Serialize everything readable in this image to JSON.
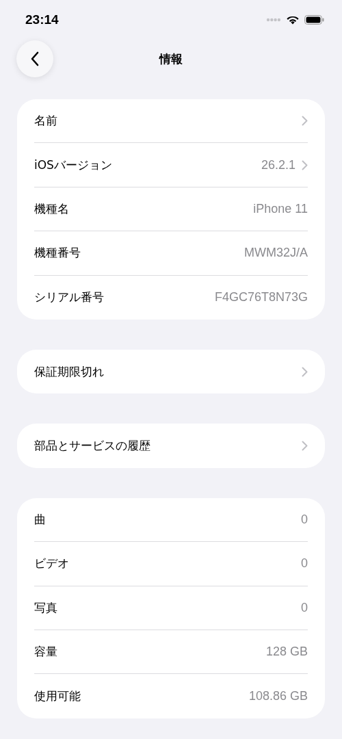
{
  "status_bar": {
    "time": "23:14"
  },
  "nav": {
    "title": "情報"
  },
  "groups": [
    {
      "rows": [
        {
          "label": "名前",
          "chevron": true
        },
        {
          "label": "iOSバージョン",
          "value": "26.2.1",
          "chevron": true
        },
        {
          "label": "機種名",
          "value": "iPhone 11"
        },
        {
          "label": "機種番号",
          "value": "MWM32J/A"
        },
        {
          "label": "シリアル番号",
          "value": "F4GC76T8N73G"
        }
      ]
    },
    {
      "rows": [
        {
          "label": "保証期限切れ",
          "chevron": true
        }
      ]
    },
    {
      "rows": [
        {
          "label": "部品とサービスの履歴",
          "chevron": true
        }
      ]
    },
    {
      "rows": [
        {
          "label": "曲",
          "value": "0"
        },
        {
          "label": "ビデオ",
          "value": "0"
        },
        {
          "label": "写真",
          "value": "0"
        },
        {
          "label": "容量",
          "value": "128 GB"
        },
        {
          "label": "使用可能",
          "value": "108.86 GB"
        }
      ]
    }
  ]
}
